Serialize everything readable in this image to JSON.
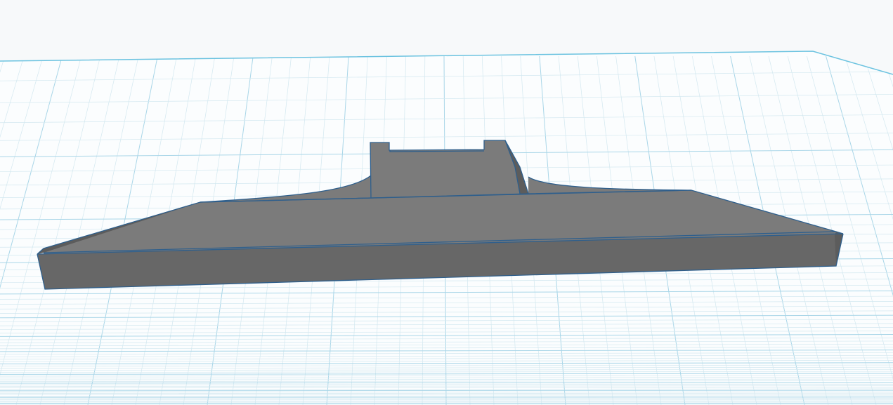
{
  "scene": {
    "background_color": "#f7f9fa",
    "grid": {
      "visible": true,
      "minor_line_color": "#d3e8f0",
      "major_line_color": "#a9d6e8",
      "edge_color": "#6cc3e0"
    },
    "model": {
      "object_name": "gray-solid-shape",
      "color_top": "#7b7b7b",
      "color_front": "#676767",
      "color_side": "#5c5c5c",
      "edge_highlight_color": "#2f5f8c",
      "selected": false
    }
  }
}
